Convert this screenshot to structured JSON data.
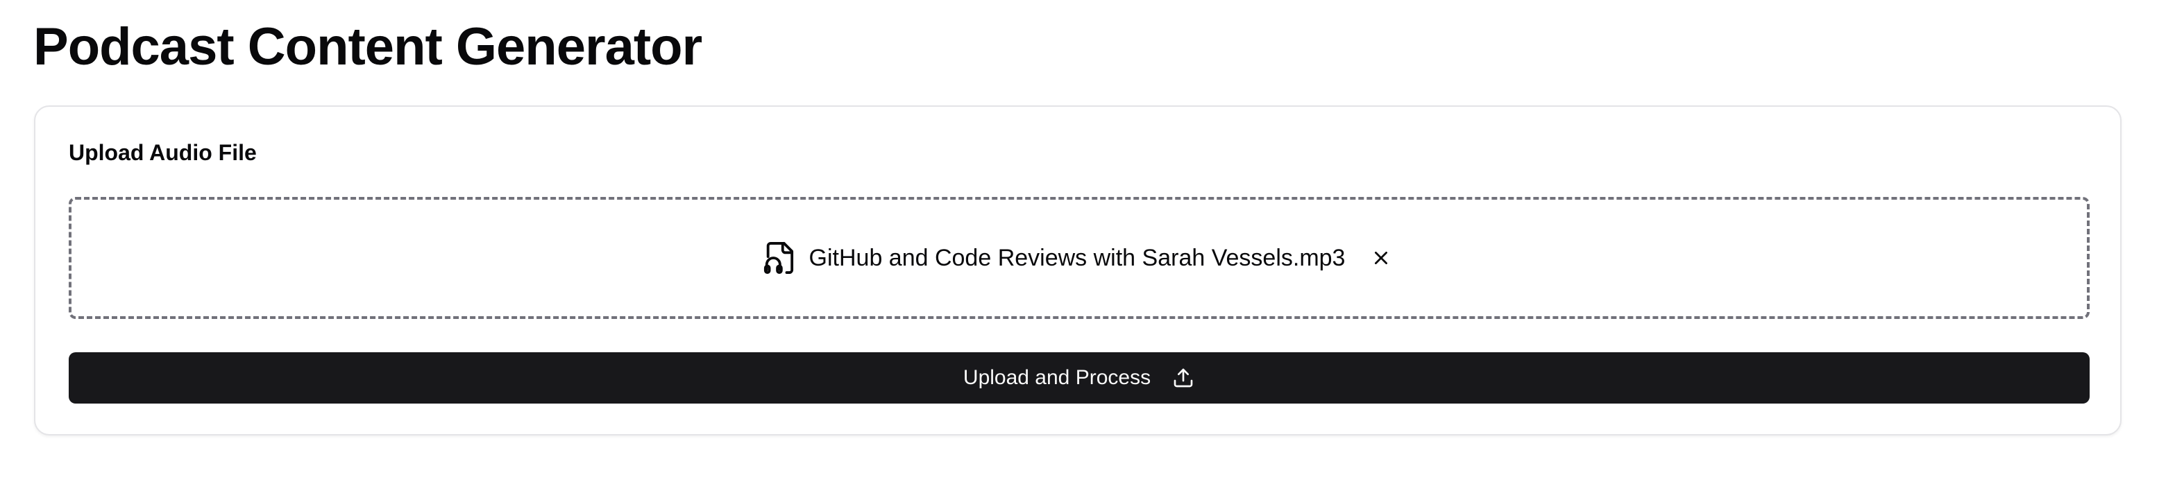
{
  "page": {
    "title": "Podcast Content Generator"
  },
  "upload_card": {
    "heading": "Upload Audio File",
    "selected_file": {
      "name": "GitHub and Code Reviews with Sarah Vessels.mp3",
      "icon": "file-audio-icon",
      "remove_icon": "close-icon"
    },
    "submit_button": {
      "label": "Upload and Process",
      "icon": "upload-icon"
    }
  },
  "colors": {
    "text": "#09090b",
    "button_bg": "#18181b",
    "button_text": "#fafafa",
    "card_border": "#e4e4e7",
    "dropzone_border": "#71717a"
  }
}
